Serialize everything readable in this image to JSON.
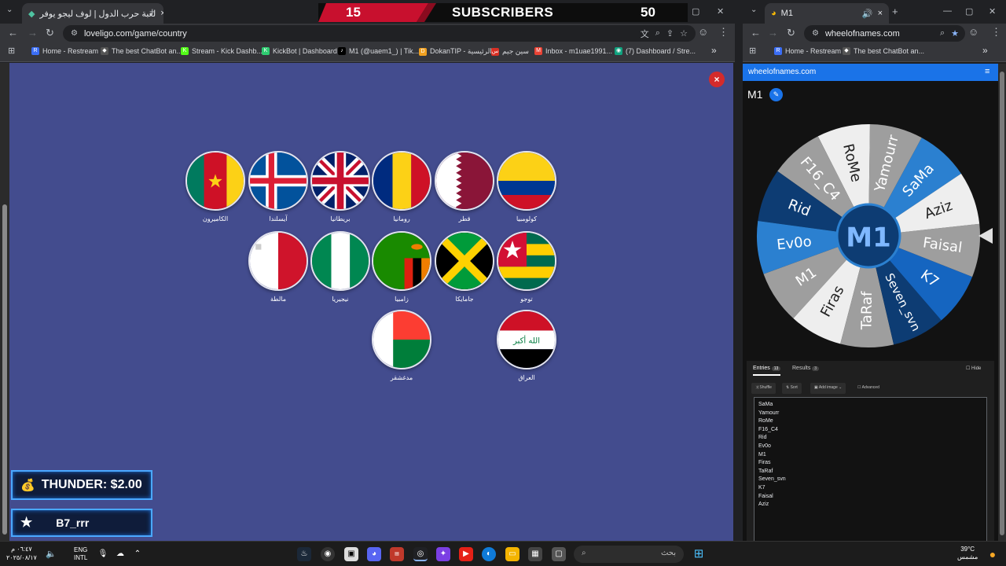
{
  "left_window": {
    "tab_title": "لعبة حرب الدول | لوف ليجو يوفر",
    "url": "loveligo.com/game/country",
    "bookmarks": [
      {
        "label": "Home - Restream",
        "color": "#3b6ef5",
        "glyph": "R"
      },
      {
        "label": "The best ChatBot an...",
        "color": "#555555",
        "glyph": "◆"
      },
      {
        "label": "Stream - Kick Dashb...",
        "color": "#53fc18",
        "glyph": "K"
      },
      {
        "label": "KickBot | Dashboard",
        "color": "#2ecc71",
        "glyph": "K"
      },
      {
        "label": "M1 (@uaem1_) | Tik...",
        "color": "#000000",
        "glyph": "♪"
      },
      {
        "label": "DokanTIP - الرئيسية",
        "color": "#f0a020",
        "glyph": "D"
      },
      {
        "label": "سين جيم",
        "color": "#d93025",
        "glyph": "س"
      },
      {
        "label": "Inbox - m1uae1991...",
        "color": "#ea4335",
        "glyph": "M"
      },
      {
        "label": "(7) Dashboard / Stre...",
        "color": "#10a37f",
        "glyph": "◉"
      }
    ],
    "more_bookmarks": "»"
  },
  "subscriber_banner": {
    "current": "15",
    "label": "SUBSCRIBERS",
    "goal": "50"
  },
  "game": {
    "close_label": "×",
    "countries": [
      {
        "name": "الكاميرون",
        "flag": "cameroon"
      },
      {
        "name": "آيسلندا",
        "flag": "iceland"
      },
      {
        "name": "بريطانيا",
        "flag": "uk"
      },
      {
        "name": "رومانيا",
        "flag": "romania"
      },
      {
        "name": "قطر",
        "flag": "qatar"
      },
      {
        "name": "كولومبيا",
        "flag": "colombia"
      },
      {
        "name": "مالطة",
        "flag": "malta"
      },
      {
        "name": "نيجيريا",
        "flag": "nigeria"
      },
      {
        "name": "زامبيا",
        "flag": "zambia"
      },
      {
        "name": "جامايكا",
        "flag": "jamaica"
      },
      {
        "name": "توجو",
        "flag": "togo"
      },
      {
        "name": "مدغشقر",
        "flag": "madagascar"
      },
      {
        "name": "العراق",
        "flag": "iraq"
      }
    ]
  },
  "overlays": {
    "donation": "THUNDER: $2.00",
    "follower": "B7_rrr"
  },
  "right_window": {
    "tab_title": "M1",
    "url": "wheelofnames.com",
    "bookmarks": [
      "Home - Restream",
      "The best ChatBot an..."
    ],
    "site_title": "wheelofnames.com",
    "wheel_title": "M1",
    "wheel_center": "M1",
    "wheel_segments": [
      "SaMa",
      "Yamourr",
      "RoMe",
      "F16_C4",
      "Rid",
      "Ev0o",
      "M1",
      "Firas",
      "TaRaf",
      "Seven_svn",
      "K7",
      "Faisal",
      "Aziz"
    ],
    "entries_tab": "Entries",
    "entries_count": "13",
    "results_tab": "Results",
    "results_count": "3",
    "hide_label": "Hide",
    "shuffle_label": "Shuffle",
    "sort_label": "Sort",
    "add_image_label": "Add image",
    "advanced_label": "Advanced",
    "entries": [
      "SaMa",
      "Yamourr",
      "RoMe",
      "F16_C4",
      "Rid",
      "Ev0o",
      "M1",
      "Firas",
      "TaRaf",
      "Seven_svn",
      "K7",
      "Faisal",
      "Aziz"
    ]
  },
  "taskbar": {
    "time": "٠٦:٤٧ م",
    "date": "٢٠٢٥/٠٨/١٧",
    "lang_top": "ENG",
    "lang_bottom": "INTL",
    "search_placeholder": "بحث",
    "weather_temp": "39°C",
    "weather_desc": "مشمس"
  },
  "colors": {
    "game_bg": "#434c8e",
    "wheel_colors": [
      "#1565c0",
      "#0d3c73",
      "#2b80d0",
      "#9e9e9e",
      "#eeeeee"
    ]
  }
}
